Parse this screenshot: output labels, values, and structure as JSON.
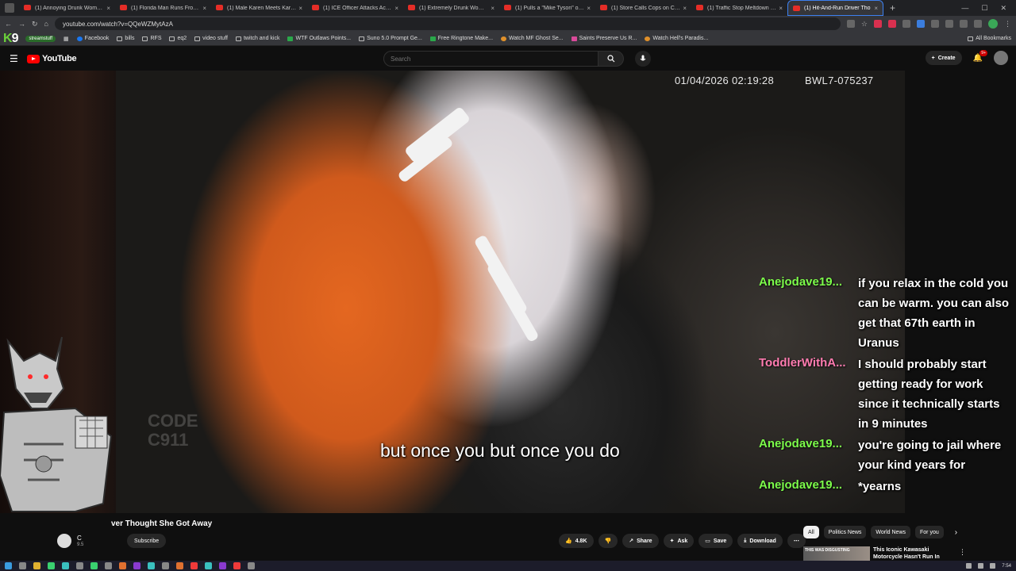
{
  "browser": {
    "tabs": [
      {
        "label": "(1) Annoying Drunk Woman Al"
      },
      {
        "label": "(1) Florida Man Runs From Poli"
      },
      {
        "label": "(1) Male Karen Meets Karma Al"
      },
      {
        "label": "(1) ICE Officer Attacks Activist -"
      },
      {
        "label": "(1) Extremely Drunk Woman Cr"
      },
      {
        "label": "(1) Pulls a \"Mike Tyson\" on His"
      },
      {
        "label": "(1) Store Calls Cops on Couple"
      },
      {
        "label": "(1) Traffic Stop Meltdown Wher"
      },
      {
        "label": "(1) Hit-And-Run Driver Tho"
      }
    ],
    "url": "youtube.com/watch?v=QQeWZMytAzA",
    "bookmarks": [
      {
        "label": "Facebook"
      },
      {
        "label": "bills"
      },
      {
        "label": "RFS"
      },
      {
        "label": "eq2"
      },
      {
        "label": "video stuff"
      },
      {
        "label": "twitch and kick"
      },
      {
        "label": "WTF Outlaws Points..."
      },
      {
        "label": "Suno 5.0 Prompt Ge..."
      },
      {
        "label": "Free Ringtone Make..."
      },
      {
        "label": "Watch MF Ghost Se..."
      },
      {
        "label": "Saints Preserve Us R..."
      },
      {
        "label": "Watch Hell's Paradis..."
      }
    ],
    "all_bookmarks": "All Bookmarks",
    "k9_logo": {
      "k": "K",
      "nine": "9"
    },
    "stream_tag": "streamstuff"
  },
  "youtube": {
    "logo_text": "YouTube",
    "search_placeholder": "Search",
    "create_label": "Create",
    "notifications_count": "9+"
  },
  "video": {
    "timestamp": "01/04/2026 02:19:28",
    "camera_id": "BWL7-075237",
    "watermark_line1": "CODE",
    "watermark_line2": "C911",
    "subtitle": "but once you but once you do"
  },
  "chat": [
    {
      "user": "Anejodave19...",
      "color": "#7cfc4a",
      "message": "if you relax in the cold you can be warm. you can also get that 67th earth in Uranus"
    },
    {
      "user": "ToddlerWithA...",
      "color": "#ff7bb0",
      "message": "I should probably start getting ready for work since it technically starts in 9 minutes"
    },
    {
      "user": "Anejodave19...",
      "color": "#7cfc4a",
      "message": "you're going to jail where your kind years for"
    },
    {
      "user": "Anejodave19...",
      "color": "#7cfc4a",
      "message": "*yearns"
    }
  ],
  "below_video": {
    "title": "ver Thought She Got Away",
    "channel_initial": "C",
    "subscriber_count": "9.5",
    "subscribe_label": "Subscribe",
    "like_count": "4.8K",
    "share_label": "Share",
    "ask_label": "Ask",
    "save_label": "Save",
    "download_label": "Download",
    "chips": [
      {
        "label": "All",
        "active": true
      },
      {
        "label": "Politics News"
      },
      {
        "label": "World News"
      },
      {
        "label": "For you"
      }
    ],
    "rec_thumb_text": "THIS WAS DISGUSTING",
    "rec_title": "This Iconic Kawasaki Motorcycle Hasn't Run In Over"
  },
  "taskbar": {
    "time": "7:54"
  }
}
